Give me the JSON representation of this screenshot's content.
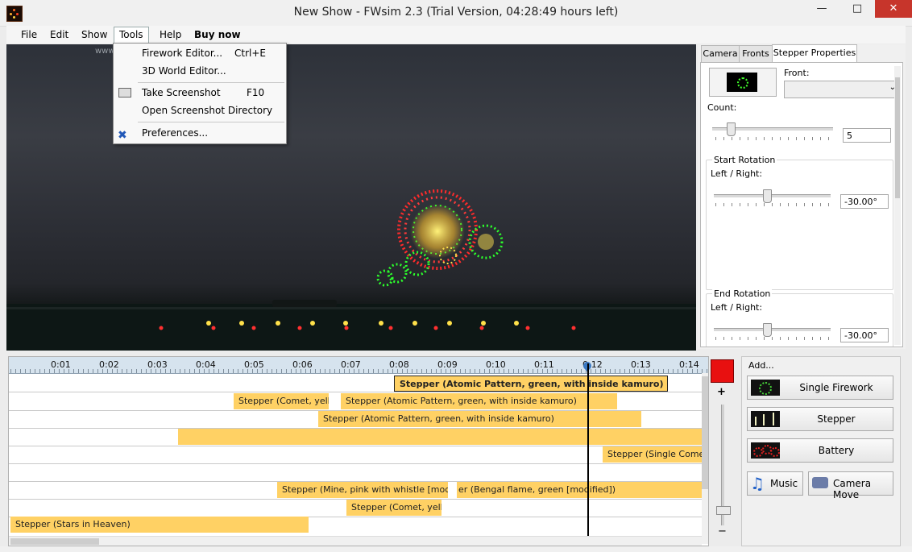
{
  "window": {
    "title": "New Show - FWsim 2.3 (Trial Version, 04:28:49 hours left)"
  },
  "menubar": {
    "file": "File",
    "edit": "Edit",
    "show": "Show",
    "tools": "Tools",
    "help": "Help",
    "buy": "Buy now"
  },
  "tools_menu": {
    "items": [
      {
        "label": "Firework Editor...",
        "shortcut": "Ctrl+E"
      },
      {
        "label": "3D World Editor...",
        "shortcut": ""
      },
      {
        "label": "Take Screenshot",
        "shortcut": "F10"
      },
      {
        "label": "Open Screenshot Directory",
        "shortcut": ""
      },
      {
        "label": "Preferences...",
        "shortcut": ""
      }
    ]
  },
  "watermark": "www.softpedia.com",
  "tabs": {
    "camera": "Camera",
    "fronts": "Fronts",
    "stepper": "Stepper Properties"
  },
  "stepper": {
    "front_label": "Front:",
    "count_label": "Count:",
    "count_value": "5",
    "count_level": 0.12,
    "start_rotation_label": "Start Rotation",
    "start_lr_label": "Left / Right:",
    "start_value": "-30.00°",
    "start_level": 0.42,
    "end_rotation_label": "End Rotation",
    "end_lr_label": "Left / Right:",
    "end_value": "-30.00°",
    "end_level": 0.42
  },
  "timeline": {
    "ticks": [
      "0:01",
      "0:02",
      "0:03",
      "0:04",
      "0:05",
      "0:06",
      "0:07",
      "0:08",
      "0:09",
      "0:10",
      "0:11",
      "0:12",
      "0:13",
      "0:14"
    ],
    "header_clip": "Stepper (Atomic Pattern, green, with inside kamuro)",
    "clips": {
      "r1a": "Stepper (Comet, yellow",
      "r1b": "Stepper (Atomic Pattern, green, with inside kamuro)",
      "r2a": "Stepper (Atomic Pattern, green, with inside kamuro)",
      "r4a": "Stepper (Single Comet w",
      "r6a": "Stepper (Mine, pink with whistle [modified])",
      "r6b": "er (Bengal flame, green [modified])",
      "r7a": "Stepper (Comet, yellow",
      "r8a": "Stepper (Stars in Heaven)"
    }
  },
  "zoom": {
    "plus": "+",
    "minus": "−"
  },
  "add_panel": {
    "title": "Add...",
    "single": "Single Firework",
    "stepper": "Stepper",
    "battery": "Battery",
    "music": "Music",
    "camera_move": "Camera Move"
  },
  "colors": {
    "clip": "#ffd164",
    "record": "#e81010",
    "red_burst": "#ff2b2b",
    "green_burst": "#2cff2c",
    "yellow_burst": "#ffe14a"
  }
}
